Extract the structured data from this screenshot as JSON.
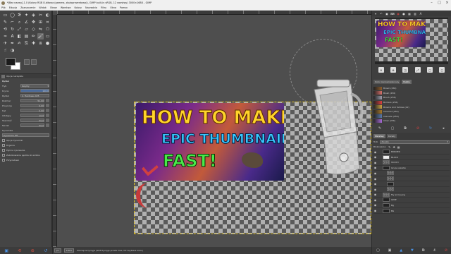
{
  "window": {
    "title": "*[Bez nazwy]-1.0 (Kolory RGB 8-bitowa (gamma, zlożoprezentowa)), GIMP built-in sRGB, 12 warstwy) 3000×1688 – GIMP"
  },
  "menu": [
    "Plik",
    "Edycja",
    "Zaznaczenie",
    "Widok",
    "Obraz",
    "Warstwa",
    "Kolory",
    "Narzędzia",
    "Filtry",
    "Okna",
    "Pomoc"
  ],
  "toolbox": {
    "tools": [
      {
        "name": "rect-select-icon",
        "glyph": "▭"
      },
      {
        "name": "ellipse-select-icon",
        "glyph": "◯"
      },
      {
        "name": "free-select-icon",
        "glyph": "ᓬ"
      },
      {
        "name": "fuzzy-select-icon",
        "glyph": "✦"
      },
      {
        "name": "color-select-icon",
        "glyph": "◈"
      },
      {
        "name": "scissors-icon",
        "glyph": "✂"
      },
      {
        "name": "foreground-select-icon",
        "glyph": "◐"
      },
      {
        "name": "paths-icon",
        "glyph": "✎"
      },
      {
        "name": "color-picker-icon",
        "glyph": "⌐"
      },
      {
        "name": "zoom-icon",
        "glyph": "⌕"
      },
      {
        "name": "measure-icon",
        "glyph": "∠"
      },
      {
        "name": "move-icon",
        "glyph": "✥"
      },
      {
        "name": "align-icon",
        "glyph": "⊞"
      },
      {
        "name": "crop-icon",
        "glyph": "⌗"
      },
      {
        "name": "unified-transform-icon",
        "glyph": "⟲"
      },
      {
        "name": "rotate-icon",
        "glyph": "↻"
      },
      {
        "name": "scale-icon",
        "glyph": "⤢"
      },
      {
        "name": "shear-icon",
        "glyph": "▱"
      },
      {
        "name": "perspective-icon",
        "glyph": "◇"
      },
      {
        "name": "flip-icon",
        "glyph": "⇋"
      },
      {
        "name": "cage-icon",
        "glyph": "⬠"
      },
      {
        "name": "warp-icon",
        "glyph": "≈"
      },
      {
        "name": "text-icon",
        "glyph": "A"
      },
      {
        "name": "bucket-fill-icon",
        "glyph": "◧"
      },
      {
        "name": "gradient-icon",
        "glyph": "▤"
      },
      {
        "name": "pencil-icon",
        "glyph": "✏"
      },
      {
        "name": "paintbrush-icon",
        "glyph": "🖌"
      },
      {
        "name": "eraser-icon",
        "glyph": "▭"
      },
      {
        "name": "airbrush-icon",
        "glyph": "✈"
      },
      {
        "name": "ink-icon",
        "glyph": "✒"
      },
      {
        "name": "mypaint-brush-icon",
        "glyph": "✍"
      },
      {
        "name": "clone-icon",
        "glyph": "⎘"
      },
      {
        "name": "heal-icon",
        "glyph": "✚"
      },
      {
        "name": "perspective-clone-icon",
        "glyph": "⧈"
      },
      {
        "name": "blur-icon",
        "glyph": "●"
      },
      {
        "name": "smudge-icon",
        "glyph": "☝"
      },
      {
        "name": "dodge-burn-icon",
        "glyph": "◑"
      }
    ],
    "active_tool_index": 26,
    "options": {
      "tab_label": "Opcje narzędzia",
      "title": "Pędzel",
      "mode_label": "Tryb",
      "mode_value": "Zwykły",
      "opacity_label": "Krycie",
      "opacity_value": "100,0",
      "brush_label": "Pędzel",
      "brush_value": "2. Hardness 025",
      "size_label": "Rozmiar",
      "size_value": "51,00",
      "aspect_label": "Proporcje",
      "aspect_value": "0,00",
      "angle_label": "Kąt",
      "angle_value": "0,00",
      "spacing_label": "Odstępy",
      "spacing_value": "10,0",
      "hardness_label": "Twardość",
      "hardness_value": "50,0",
      "force_label": "Nacisk",
      "force_value": "50,0",
      "dynamics_label": "Dynamika",
      "dynamics_value": "Dynamics Off",
      "checks": [
        "Opcje dynamiki",
        "Drgania",
        "Płynne rysowanie",
        "Zablokowanie pędzla do widoku",
        "Przyrostowo"
      ]
    }
  },
  "canvas": {
    "thumbnail": {
      "line1": "HOW TO MAKE",
      "line2": "EPIC THUMBNAIL",
      "line3": "FAST!"
    },
    "status": {
      "unit": "px",
      "zoom": "100%",
      "message": "Kliknięcie tyczyje (Shift tyczyje proste linie, Ctrl wybiera kolor)"
    }
  },
  "right_dock": {
    "nav_buttons": [
      "⊖",
      "⊕",
      "◳",
      "⤢",
      "▢",
      "◻"
    ],
    "grad_tabs": [
      "Kolor pierwszoplanowy",
      "Paleta"
    ],
    "gradients": [
      {
        "name": "Brown (256)",
        "color": "#8a5a2a"
      },
      {
        "name": "Blush (256)",
        "color": "#d8706a"
      },
      {
        "name": "Brush (256)",
        "color": "#9a9aaa"
      },
      {
        "name": "Borders (256)",
        "color": "#d94040"
      },
      {
        "name": "Browns And Yellows (22)",
        "color": "#c8a040"
      },
      {
        "name": "Caramel (256)",
        "color": "#a8782a"
      },
      {
        "name": "Cascade (256)",
        "color": "#5a7aaa"
      },
      {
        "name": "Chiar (256)",
        "color": "#a86ad8"
      }
    ],
    "layer_tabs": [
      "Warstwy",
      "Kanały"
    ],
    "layers_mode_label": "Tryb",
    "layers_mode_value": "Zwykły",
    "lock_label": "Blokowanie:",
    "layers": [
      {
        "name": "BORDER",
        "thumb": "dark",
        "indent": false
      },
      {
        "name": "BLACK",
        "thumb": "white",
        "indent": false,
        "selected": false
      },
      {
        "name": "html13",
        "thumb": "checker",
        "indent": false
      },
      {
        "name": "Grupa warstw",
        "thumb": "dark",
        "indent": false
      },
      {
        "name": "",
        "thumb": "checker",
        "indent": true
      },
      {
        "name": "",
        "thumb": "checker",
        "indent": true
      },
      {
        "name": "",
        "thumb": "dark",
        "indent": true
      },
      {
        "name": "",
        "thumb": "checker",
        "indent": true
      },
      {
        "name": "My arrow.png",
        "thumb": "checker",
        "indent": false
      },
      {
        "name": "GIMP",
        "thumb": "dark",
        "indent": false
      },
      {
        "name": "Bg",
        "thumb": "dark",
        "indent": false
      },
      {
        "name": "BG",
        "thumb": "dark",
        "indent": false
      }
    ]
  }
}
